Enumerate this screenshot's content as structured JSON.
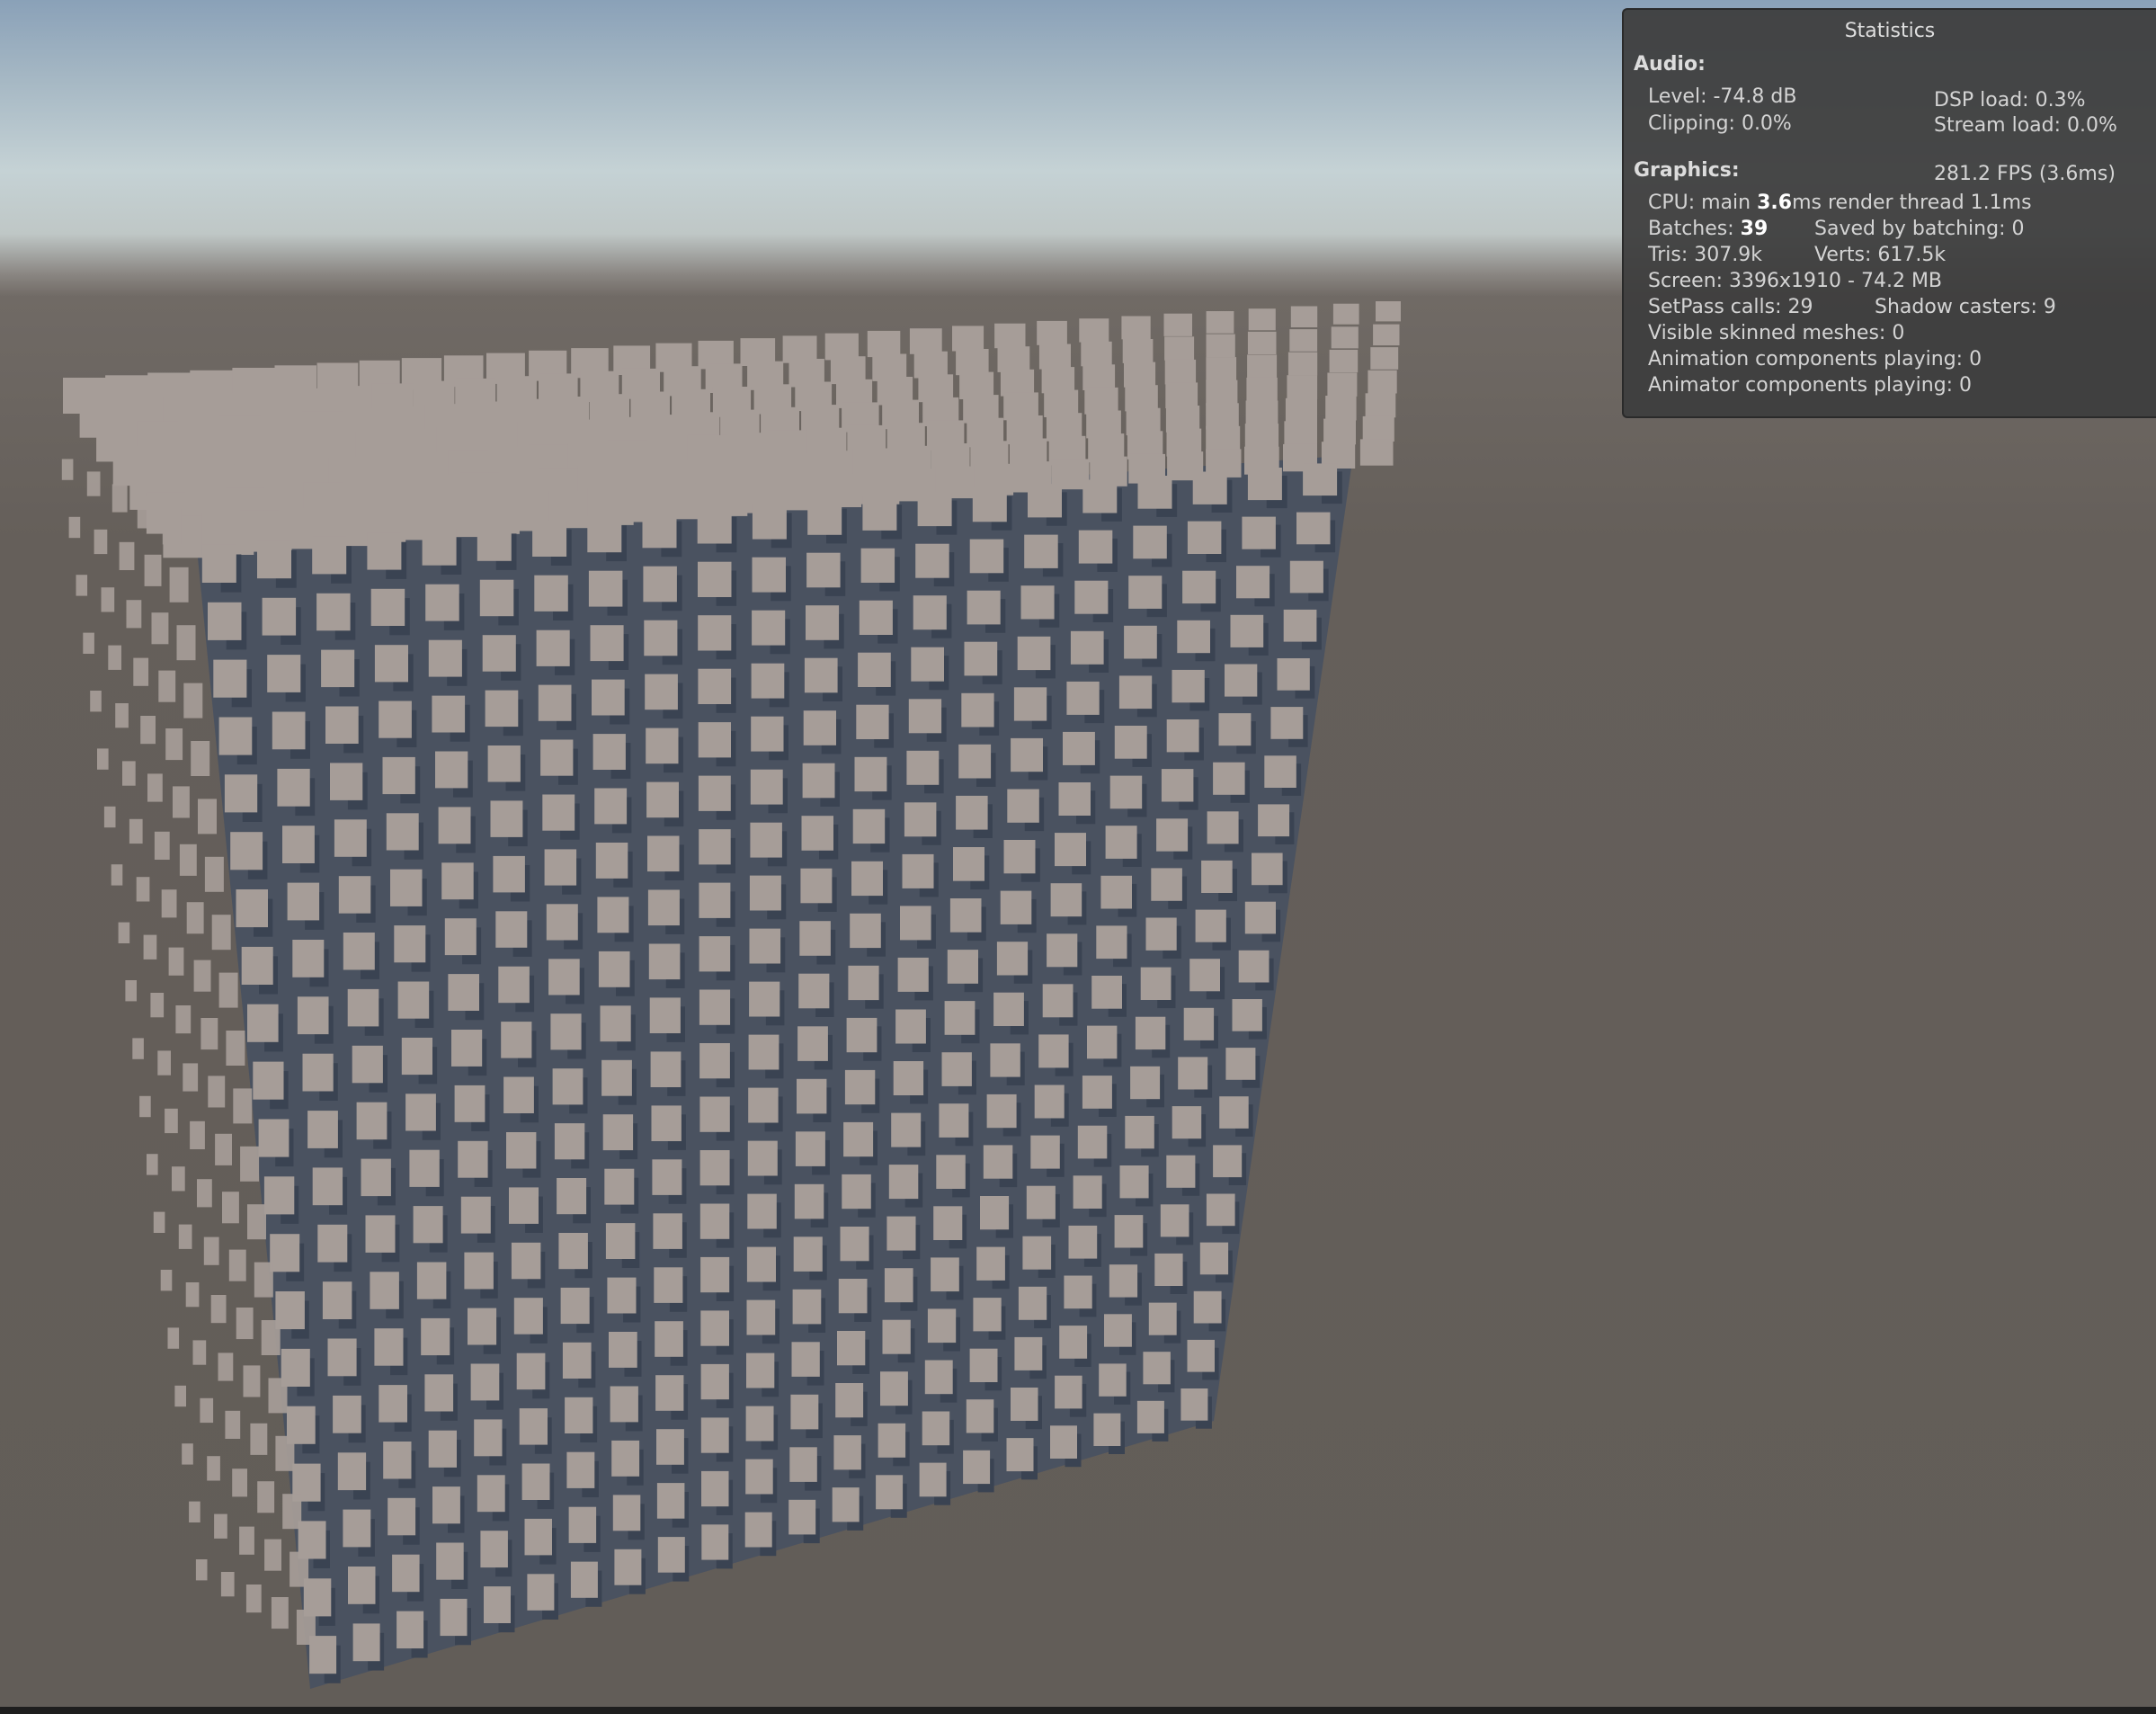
{
  "statistics": {
    "title": "Statistics",
    "audio": {
      "heading": "Audio:",
      "level": "Level: -74.8 dB",
      "clipping": "Clipping: 0.0%",
      "dsp_load": "DSP load: 0.3%",
      "stream_load": "Stream load: 0.0%"
    },
    "graphics": {
      "heading": "Graphics:",
      "fps": "281.2 FPS (3.6ms)",
      "cpu_label": "CPU: main ",
      "cpu_main_value": "3.6",
      "cpu_rest": "ms  render thread 1.1ms",
      "batches_label": "Batches: ",
      "batches_value": "39",
      "saved_by_batching": "Saved by batching: 0",
      "tris": "Tris: 307.9k",
      "verts": "Verts: 617.5k",
      "screen": "Screen: 3396x1910 - 74.2 MB",
      "setpass": "SetPass calls: 29",
      "shadow_casters": "Shadow casters: 9",
      "visible_skinned": "Visible skinned meshes: 0",
      "animation_components": "Animation components playing: 0",
      "animator_components": "Animator components playing: 0"
    }
  },
  "scene": {
    "sky_top_color": "#8aa1b8",
    "horizon_color": "#c5d2d5",
    "ground_color": "#625d58",
    "cube_face_color": "#a69d98",
    "cube_shadow_color": "#3a4352"
  }
}
